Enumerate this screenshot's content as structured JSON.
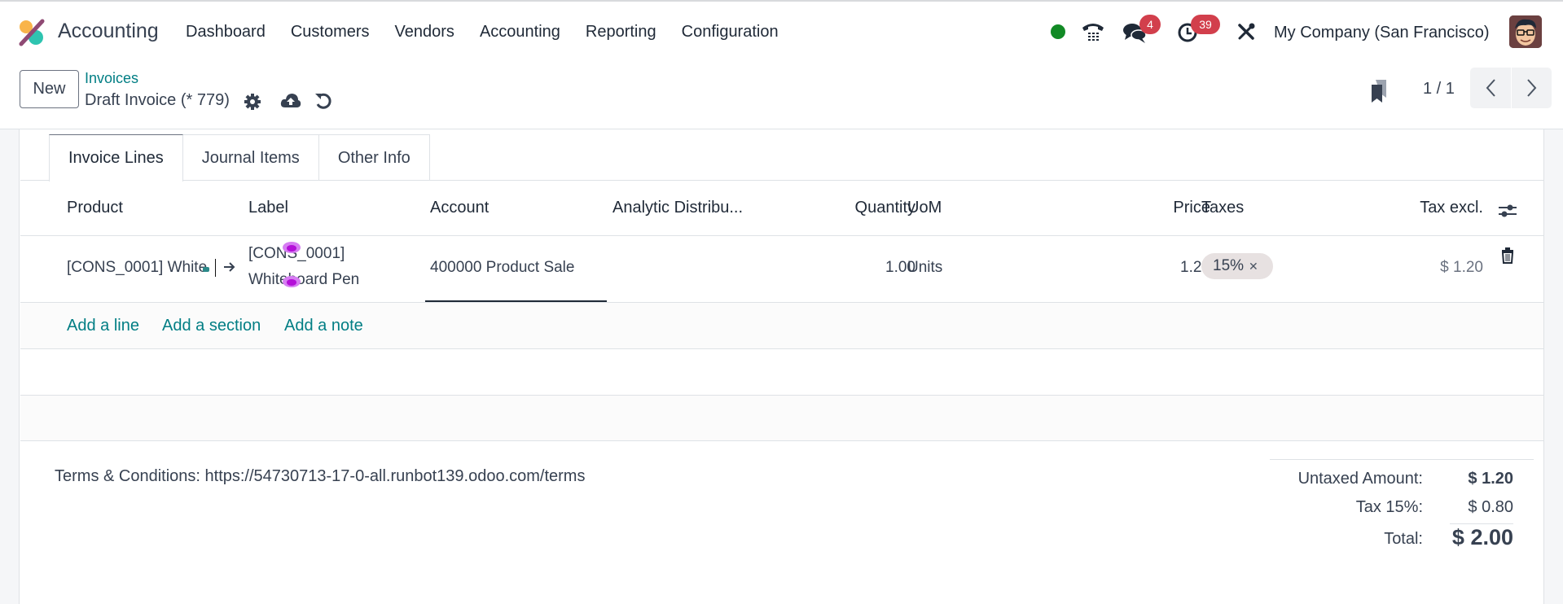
{
  "navbar": {
    "app_name": "Accounting",
    "menu": [
      "Dashboard",
      "Customers",
      "Vendors",
      "Accounting",
      "Reporting",
      "Configuration"
    ],
    "messages_badge": "4",
    "activities_badge": "39",
    "company": "My Company (San Francisco)",
    "status_color": "#128a25"
  },
  "control_panel": {
    "new_label": "New",
    "breadcrumb_parent": "Invoices",
    "breadcrumb_current": "Draft Invoice (* 779)",
    "pager_value": "1 / 1"
  },
  "tabs": [
    {
      "label": "Invoice Lines",
      "active": true
    },
    {
      "label": "Journal Items",
      "active": false
    },
    {
      "label": "Other Info",
      "active": false
    }
  ],
  "table": {
    "columns": [
      "Product",
      "Label",
      "Account",
      "Analytic Distribu...",
      "Quantity",
      "UoM",
      "Price",
      "Taxes",
      "Tax excl."
    ],
    "rows": [
      {
        "product": "[CONS_0001] White",
        "label_line1": "[CONS_0001]",
        "label_line2": "Whiteboard Pen",
        "account": "400000 Product Sale",
        "analytic": "",
        "quantity": "1.00",
        "uom": "Units",
        "price": "1.20",
        "tax_tag": "15%",
        "subtotal": "$ 1.20"
      }
    ],
    "add_line": "Add a line",
    "add_section": "Add a section",
    "add_note": "Add a note"
  },
  "footer": {
    "terms": "Terms & Conditions: https://54730713-17-0-all.runbot139.odoo.com/terms",
    "untaxed_label": "Untaxed Amount:",
    "untaxed_value": "$ 1.20",
    "tax_label": "Tax 15%:",
    "tax_value": "$ 0.80",
    "total_label": "Total:",
    "total_value": "$ 2.00"
  },
  "colors": {
    "link": "#017e84",
    "badge": "#d23f4c",
    "tag": "#e7e1e1"
  }
}
